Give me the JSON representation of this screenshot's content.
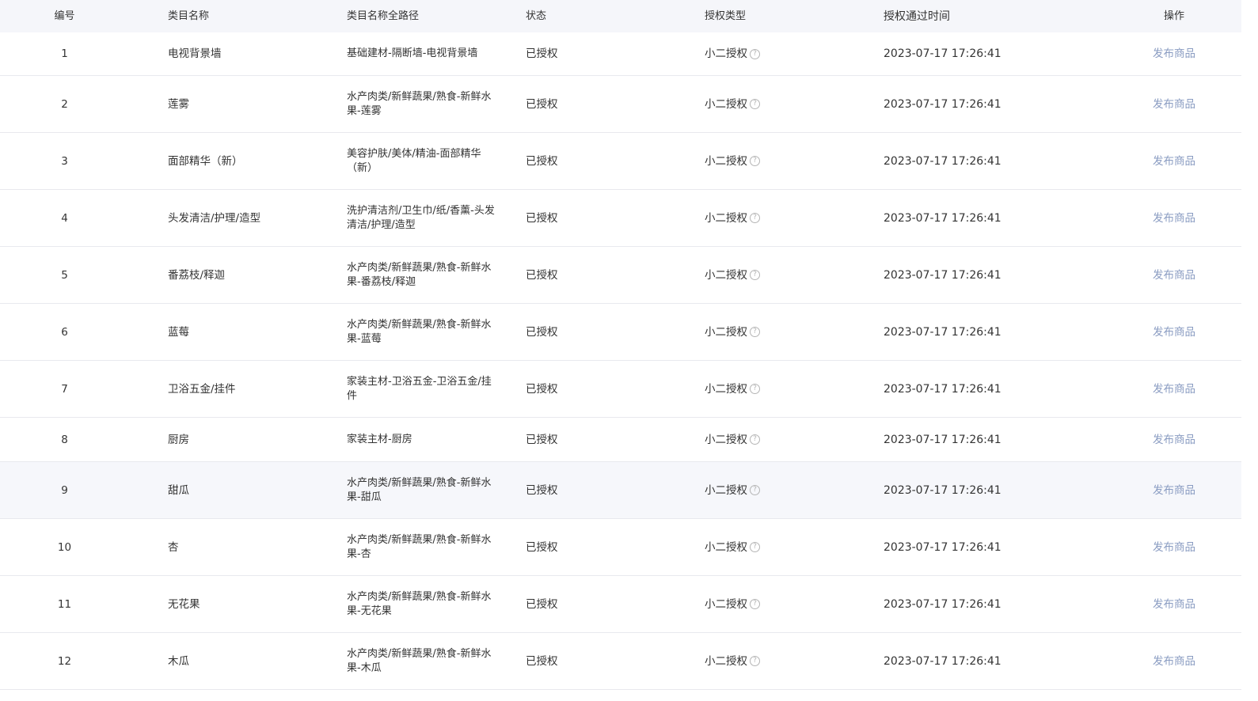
{
  "header": {
    "no": "编号",
    "name": "类目名称",
    "path": "类目名称全路径",
    "status": "状态",
    "auth_type": "授权类型",
    "time": "授权通过时间",
    "action": "操作"
  },
  "help_glyph": "?",
  "rows": [
    {
      "no": "1",
      "name": "电视背景墙",
      "path": "基础建材-隔断墙-电视背景墙",
      "status": "已授权",
      "auth_type": "小二授权",
      "time": "2023-07-17 17:26:41",
      "action": "发布商品"
    },
    {
      "no": "2",
      "name": "莲雾",
      "path": "水产肉类/新鲜蔬果/熟食-新鲜水果-莲雾",
      "status": "已授权",
      "auth_type": "小二授权",
      "time": "2023-07-17 17:26:41",
      "action": "发布商品"
    },
    {
      "no": "3",
      "name": "面部精华（新）",
      "path": "美容护肤/美体/精油-面部精华（新）",
      "status": "已授权",
      "auth_type": "小二授权",
      "time": "2023-07-17 17:26:41",
      "action": "发布商品"
    },
    {
      "no": "4",
      "name": "头发清洁/护理/造型",
      "path": "洗护清洁剂/卫生巾/纸/香薰-头发清洁/护理/造型",
      "status": "已授权",
      "auth_type": "小二授权",
      "time": "2023-07-17 17:26:41",
      "action": "发布商品"
    },
    {
      "no": "5",
      "name": "番荔枝/释迦",
      "path": "水产肉类/新鲜蔬果/熟食-新鲜水果-番荔枝/释迦",
      "status": "已授权",
      "auth_type": "小二授权",
      "time": "2023-07-17 17:26:41",
      "action": "发布商品"
    },
    {
      "no": "6",
      "name": "蓝莓",
      "path": "水产肉类/新鲜蔬果/熟食-新鲜水果-蓝莓",
      "status": "已授权",
      "auth_type": "小二授权",
      "time": "2023-07-17 17:26:41",
      "action": "发布商品"
    },
    {
      "no": "7",
      "name": "卫浴五金/挂件",
      "path": "家装主材-卫浴五金-卫浴五金/挂件",
      "status": "已授权",
      "auth_type": "小二授权",
      "time": "2023-07-17 17:26:41",
      "action": "发布商品"
    },
    {
      "no": "8",
      "name": "厨房",
      "path": "家装主材-厨房",
      "status": "已授权",
      "auth_type": "小二授权",
      "time": "2023-07-17 17:26:41",
      "action": "发布商品"
    },
    {
      "no": "9",
      "name": "甜瓜",
      "path": "水产肉类/新鲜蔬果/熟食-新鲜水果-甜瓜",
      "status": "已授权",
      "auth_type": "小二授权",
      "time": "2023-07-17 17:26:41",
      "action": "发布商品"
    },
    {
      "no": "10",
      "name": "杏",
      "path": "水产肉类/新鲜蔬果/熟食-新鲜水果-杏",
      "status": "已授权",
      "auth_type": "小二授权",
      "time": "2023-07-17 17:26:41",
      "action": "发布商品"
    },
    {
      "no": "11",
      "name": "无花果",
      "path": "水产肉类/新鲜蔬果/熟食-新鲜水果-无花果",
      "status": "已授权",
      "auth_type": "小二授权",
      "time": "2023-07-17 17:26:41",
      "action": "发布商品"
    },
    {
      "no": "12",
      "name": "木瓜",
      "path": "水产肉类/新鲜蔬果/熟食-新鲜水果-木瓜",
      "status": "已授权",
      "auth_type": "小二授权",
      "time": "2023-07-17 17:26:41",
      "action": "发布商品"
    }
  ]
}
